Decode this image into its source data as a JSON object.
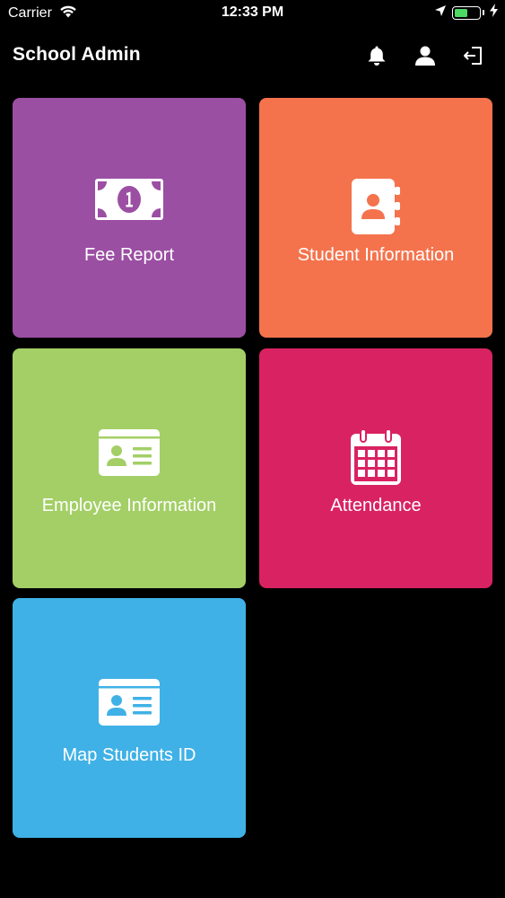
{
  "status_bar": {
    "carrier": "Carrier",
    "time": "12:33 PM",
    "battery_level": 0.45,
    "battery_color": "#4cd964"
  },
  "nav": {
    "title": "School Admin",
    "icons": [
      "bell-icon",
      "user-icon",
      "logout-icon"
    ]
  },
  "tiles": [
    {
      "label": "Fee Report",
      "color": "#9b4fa3",
      "icon": "banknote-icon"
    },
    {
      "label": "Student Information",
      "color": "#f4734d",
      "icon": "contact-book-icon"
    },
    {
      "label": "Employee Information",
      "color": "#a3cf66",
      "icon": "id-card-icon"
    },
    {
      "label": "Attendance",
      "color": "#d92262",
      "icon": "calendar-icon"
    },
    {
      "label": "Map Students ID",
      "color": "#3fb1e6",
      "icon": "id-card-icon"
    }
  ]
}
